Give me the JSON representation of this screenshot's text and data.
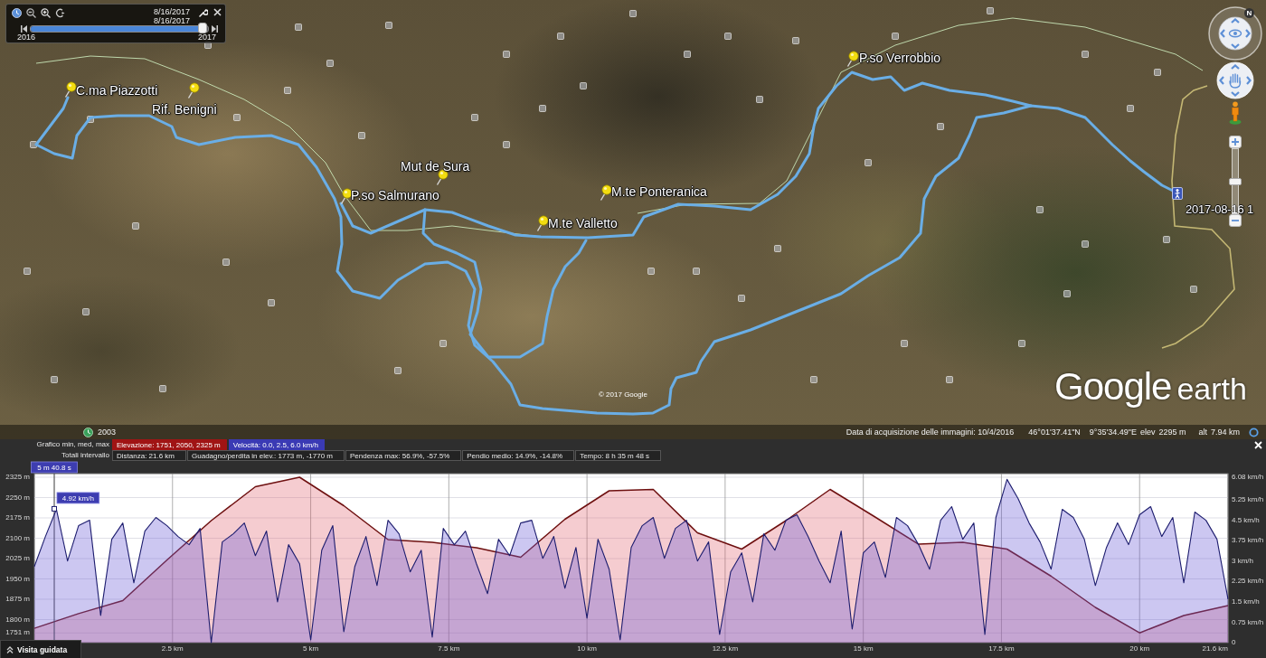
{
  "time_slider": {
    "start_date": "8/16/2017",
    "end_date": "8/16/2017",
    "level": 0.97,
    "min_label": "2016",
    "max_label": "2017"
  },
  "map": {
    "placemarks": [
      {
        "kind": "pin",
        "label": "C.ma Piazzotti"
      },
      {
        "kind": "pin",
        "label": "Rif. Benigni"
      },
      {
        "kind": "pin",
        "label": "Mut de Sura"
      },
      {
        "kind": "pin",
        "label": "P.so Salmurano"
      },
      {
        "kind": "pin",
        "label": "M.te Ponteranica"
      },
      {
        "kind": "pin",
        "label": "M.te Valletto"
      },
      {
        "kind": "pin",
        "label": "P.so Verrobbio"
      },
      {
        "kind": "track-end",
        "label": "2017-08-16 1"
      }
    ],
    "copyright": "© 2017 Google",
    "logo": {
      "brand": "Google",
      "product": "earth"
    }
  },
  "navigation": {
    "north": "N",
    "zoom": {
      "level": 0.5
    }
  },
  "status_bar": {
    "historical_year": "2003",
    "imagery_date": "Data di acquisizione delle immagini: 10/4/2016",
    "latitude": "46°01'37.41\"N",
    "longitude": "9°35'34.49\"E",
    "elev_label": "elev",
    "elev_value": "2295 m",
    "alt_label": "alt",
    "alt_value": "7.94 km"
  },
  "profile": {
    "legend_label": "Grafico min, med, max",
    "series_toggles": [
      {
        "label": "Elevazione: 1751, 2050, 2325 m",
        "color": "#a01414",
        "selected": true
      },
      {
        "label": "Velocità: 0.0, 2.5, 6.0 km/h",
        "color": "#3a3ab4",
        "selected": true
      }
    ],
    "totals_label": "Totali intervallo",
    "totals": [
      "Distanza: 21.6 km",
      "Guadagno/perdita in elev.: 1773 m, -1770 m",
      "Pendenza max: 56.9%, -57.5%",
      "Pendio medio: 14.9%, -14.8%",
      "Tempo: 8 h 35 m 48 s"
    ],
    "elevation_chart": {
      "chart_data": {
        "type": "area",
        "x": [
          0,
          0.8,
          1.6,
          2.4,
          3.2,
          4,
          4.8,
          5.6,
          6.4,
          7.2,
          8,
          8.8,
          9.6,
          10.4,
          11.2,
          12,
          12.8,
          13.6,
          14.4,
          15.2,
          16,
          16.8,
          17.6,
          18.4,
          19.2,
          20,
          20.8,
          21.6
        ],
        "series": [
          {
            "color": "#6e1010",
            "values": [
              1768,
              1822,
              1870,
              2020,
              2165,
              2290,
              2325,
              2220,
              2095,
              2085,
              2065,
              2030,
              2170,
              2275,
              2280,
              2120,
              2060,
              2165,
              2280,
              2180,
              2078,
              2085,
              2060,
              1960,
              1845,
              1751,
              1815,
              1852
            ]
          }
        ],
        "xlim": [
          0,
          21.6
        ],
        "ylim": [
          1715,
          2325
        ],
        "xticks": [
          {
            "value": 2.5,
            "label": "2.5 km"
          },
          {
            "value": 5,
            "label": "5 km"
          },
          {
            "value": 7.5,
            "label": "7.5 km"
          },
          {
            "value": 10,
            "label": "10 km"
          },
          {
            "value": 12.5,
            "label": "12.5 km"
          },
          {
            "value": 15,
            "label": "15 km"
          },
          {
            "value": 17.5,
            "label": "17.5 km"
          },
          {
            "value": 20,
            "label": "20 km"
          },
          {
            "value": 21.6,
            "label": "21.6 km"
          }
        ],
        "yticks": [
          {
            "value": 1751,
            "label": "1751 m"
          },
          {
            "value": 1800,
            "label": "1800 m"
          },
          {
            "value": 1875,
            "label": "1875 m"
          },
          {
            "value": 1950,
            "label": "1950 m"
          },
          {
            "value": 2025,
            "label": "2025 m"
          },
          {
            "value": 2100,
            "label": "2100 m"
          },
          {
            "value": 2175,
            "label": "2175 m"
          },
          {
            "value": 2250,
            "label": "2250 m"
          },
          {
            "value": 2325,
            "label": "2325 m"
          }
        ],
        "grid": true,
        "ref_lines": [
          {
            "axis": "x",
            "value": 0.36
          }
        ],
        "annotations": [
          "5 m 40.8 s"
        ]
      }
    },
    "speed_chart": {
      "chart_data": {
        "type": "area",
        "x": [
          0,
          0.2,
          0.4,
          0.6,
          0.8,
          1,
          1.2,
          1.4,
          1.6,
          1.8,
          2,
          2.2,
          2.4,
          2.6,
          2.8,
          3,
          3.2,
          3.4,
          3.6,
          3.8,
          4,
          4.2,
          4.4,
          4.6,
          4.8,
          5,
          5.2,
          5.4,
          5.6,
          5.8,
          6,
          6.2,
          6.4,
          6.6,
          6.8,
          7,
          7.2,
          7.4,
          7.6,
          7.8,
          8,
          8.2,
          8.4,
          8.6,
          8.8,
          9,
          9.2,
          9.4,
          9.6,
          9.8,
          10,
          10.2,
          10.4,
          10.6,
          10.8,
          11,
          11.2,
          11.4,
          11.6,
          11.8,
          12,
          12.2,
          12.4,
          12.6,
          12.8,
          13,
          13.2,
          13.4,
          13.6,
          13.8,
          14,
          14.2,
          14.4,
          14.6,
          14.8,
          15,
          15.2,
          15.4,
          15.6,
          15.8,
          16,
          16.2,
          16.4,
          16.6,
          16.8,
          17,
          17.2,
          17.4,
          17.6,
          17.8,
          18,
          18.2,
          18.4,
          18.6,
          18.8,
          19,
          19.2,
          19.4,
          19.6,
          19.8,
          20,
          20.2,
          20.4,
          20.6,
          20.8,
          21,
          21.2,
          21.4,
          21.6
        ],
        "series": [
          {
            "color": "#1d1d6e",
            "values": [
              2.8,
              3.9,
              4.9,
              3.0,
              4.3,
              4.5,
              1.0,
              3.8,
              4.4,
              2.2,
              4.1,
              4.6,
              4.3,
              3.9,
              3.6,
              4.2,
              0.0,
              3.7,
              4.0,
              4.4,
              3.2,
              4.1,
              1.5,
              3.6,
              2.9,
              0.1,
              3.4,
              4.3,
              0.4,
              2.8,
              3.9,
              2.1,
              4.5,
              4.0,
              2.6,
              3.4,
              0.2,
              4.2,
              3.6,
              4.1,
              2.9,
              1.8,
              3.8,
              3.2,
              4.4,
              4.5,
              3.1,
              3.9,
              2.0,
              3.5,
              0.9,
              3.8,
              2.7,
              0.1,
              3.5,
              4.3,
              4.6,
              3.1,
              4.2,
              4.5,
              3.0,
              3.7,
              0.3,
              2.6,
              3.3,
              1.5,
              4.0,
              3.4,
              4.5,
              4.7,
              3.9,
              3.0,
              2.2,
              4.1,
              0.5,
              3.3,
              3.7,
              2.4,
              4.6,
              4.3,
              3.6,
              2.7,
              4.5,
              5.0,
              3.8,
              4.4,
              0.3,
              4.6,
              6.0,
              5.3,
              4.4,
              3.7,
              2.7,
              4.9,
              4.6,
              3.8,
              2.1,
              3.5,
              4.4,
              3.6,
              4.7,
              5.0,
              3.9,
              4.6,
              2.2,
              4.8,
              4.5,
              3.8,
              1.6
            ]
          }
        ],
        "xlim": [
          0,
          21.6
        ],
        "ylim": [
          0,
          6.08
        ],
        "yticks": [
          {
            "value": 0,
            "label": "0"
          },
          {
            "value": 0.75,
            "label": "0.75 km/h"
          },
          {
            "value": 1.5,
            "label": "1.5 km/h"
          },
          {
            "value": 2.25,
            "label": "2.25 km/h"
          },
          {
            "value": 3,
            "label": "3 km/h"
          },
          {
            "value": 3.75,
            "label": "3.75 km/h"
          },
          {
            "value": 4.5,
            "label": "4.5 km/h"
          },
          {
            "value": 5.25,
            "label": "5.25 km/h"
          },
          {
            "value": 6.08,
            "label": "6.08 km/h"
          }
        ],
        "annotations": [
          {
            "x": 0.36,
            "y": 4.92,
            "text": "4.92 km/h"
          }
        ]
      }
    },
    "guided_tour": "Visita guidata"
  }
}
